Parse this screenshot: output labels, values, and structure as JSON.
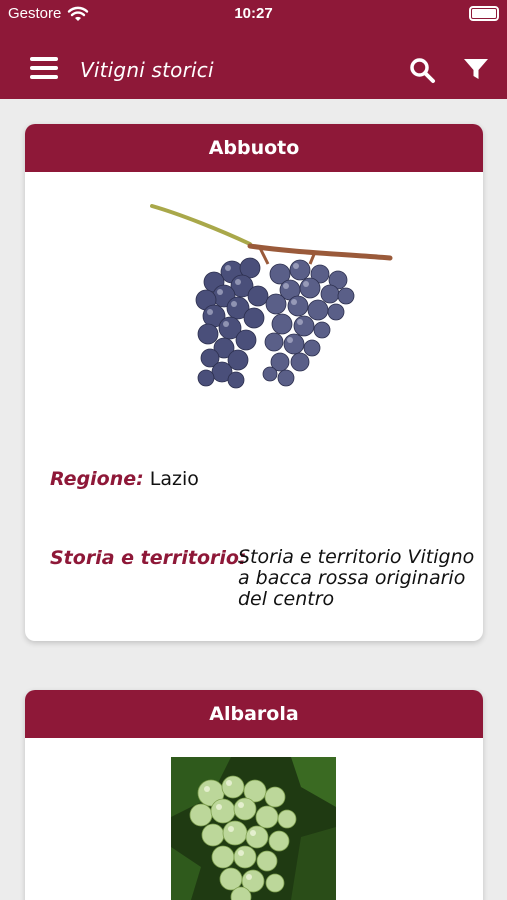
{
  "status_bar": {
    "carrier": "Gestore",
    "time": "10:27"
  },
  "nav": {
    "title": "Vitigni storici",
    "menu_icon": "hamburger-menu-icon",
    "search_icon": "search-icon",
    "filter_icon": "filter-icon"
  },
  "cards": [
    {
      "title": "Abbuoto",
      "image": "grape-cluster-dark",
      "regione_label": "Regione:",
      "regione_value": "Lazio",
      "storia_label": "Storia e territorio:",
      "storia_value": "Storia e territorio Vitigno a bacca rossa originario del centro"
    },
    {
      "title": "Albarola",
      "image": "grape-cluster-white"
    }
  ],
  "colors": {
    "brand": "#8e1838",
    "background": "#ececec"
  }
}
